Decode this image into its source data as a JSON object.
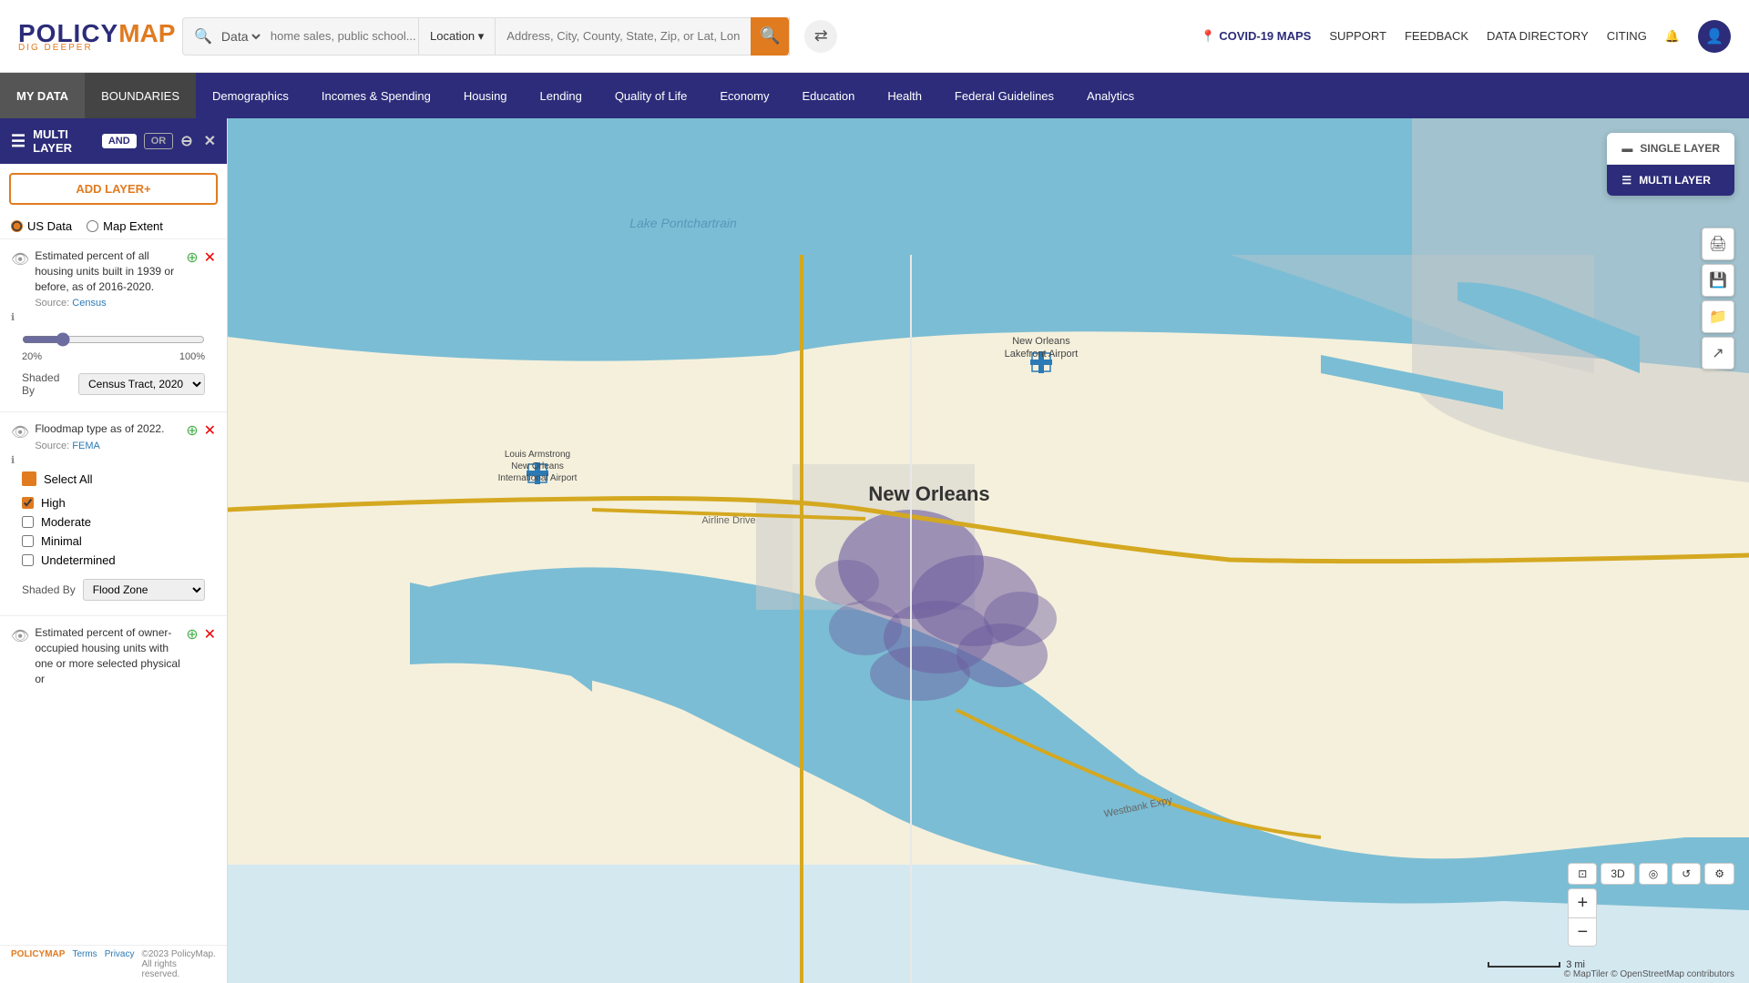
{
  "app": {
    "name": "POLICYMAP",
    "tagline": "DIG DEEPER",
    "covid_link": "COVID-19 MAPS",
    "support": "SUPPORT",
    "feedback": "FEEDBACK",
    "data_directory": "DATA DIRECTORY",
    "citing": "CITING"
  },
  "search": {
    "data_label": "Data",
    "placeholder": "home sales, public school...",
    "location_label": "Location",
    "location_placeholder": "Address, City, County, State, Zip, or Lat, Long"
  },
  "navbar": {
    "my_data": "MY DATA",
    "boundaries": "BOUNDARIES",
    "items": [
      {
        "label": "Demographics"
      },
      {
        "label": "Incomes & Spending"
      },
      {
        "label": "Housing"
      },
      {
        "label": "Lending"
      },
      {
        "label": "Quality of Life"
      },
      {
        "label": "Economy"
      },
      {
        "label": "Education"
      },
      {
        "label": "Health"
      },
      {
        "label": "Federal Guidelines"
      },
      {
        "label": "Analytics"
      }
    ]
  },
  "sidebar": {
    "multi_layer": "MULTI LAYER",
    "and_label": "AND",
    "or_label": "OR",
    "add_layer": "ADD LAYER+",
    "us_data": "US Data",
    "map_extent": "Map Extent",
    "layer1": {
      "description": "Estimated percent of all housing units built in 1939 or before, as of 2016-2020.",
      "source_label": "Source:",
      "source": "Census",
      "range_min": "20%",
      "range_max": "100%"
    },
    "shaded_by_label": "Shaded By",
    "shaded_by_value": "Census Tract, 2020",
    "layer2": {
      "description": "Floodmap type as of 2022.",
      "source_label": "Source:",
      "source": "FEMA",
      "select_all": "Select All",
      "checkboxes": [
        {
          "label": "High",
          "checked": true
        },
        {
          "label": "Moderate",
          "checked": false
        },
        {
          "label": "Minimal",
          "checked": false
        },
        {
          "label": "Undetermined",
          "checked": false
        }
      ]
    },
    "shaded_by_label2": "Shaded By",
    "shaded_by_value2": "Flood Zone",
    "layer3": {
      "description": "Estimated percent of owner-occupied housing units with one or more selected physical or"
    }
  },
  "layer_switcher": {
    "single_label": "SINGLE LAYER",
    "multi_label": "MULTI LAYER"
  },
  "map": {
    "city_label": "New Orleans",
    "airport1": "New Orleans Lakefront Airport",
    "airport2": "Louis Armstrong New Orleans International Airport",
    "road": "Airline Drive",
    "road2": "Westbank Expy",
    "scale": "3 mi",
    "attribution": "© MapTiler © OpenStreetMap contributors"
  },
  "footer": {
    "brand": "POLICYMAP",
    "terms": "Terms",
    "privacy": "Privacy",
    "copyright": "©2023 PolicyMap. All rights reserved."
  }
}
